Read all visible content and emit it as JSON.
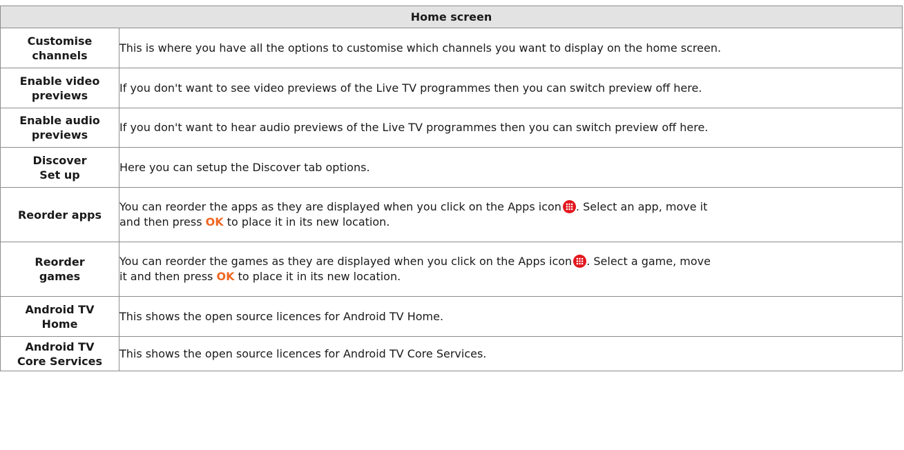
{
  "table": {
    "header": "Home screen",
    "rows": [
      {
        "label_line1": "Customise",
        "label_line2": "channels",
        "desc": "This is where you have all the options to customise which channels you want to display on the home screen."
      },
      {
        "label_line1": "Enable video",
        "label_line2": "previews",
        "desc": "If you don't want to see video previews of the Live TV programmes then you can switch preview off here."
      },
      {
        "label_line1": "Enable audio",
        "label_line2": "previews",
        "desc": "If you don't want to hear audio previews of the Live TV programmes then you can switch preview off here."
      },
      {
        "label_line1": "Discover",
        "label_line2": "Set up",
        "desc": "Here you can setup the Discover tab options."
      },
      {
        "label": "Reorder apps",
        "desc_a": "You can reorder the apps as they are displayed when you click on the Apps icon",
        "desc_b": ". Select an app, move it",
        "desc_c": "and then press",
        "desc_ok": "OK",
        "desc_d": "to place it in its new location.",
        "icon": "apps-grid-icon"
      },
      {
        "label_line1": "Reorder",
        "label_line2": "games",
        "desc_a": "You can reorder the games as they are displayed when you click on the Apps icon",
        "desc_b": ". Select a game, move",
        "desc_c": "it and then press",
        "desc_ok": "OK",
        "desc_d": "to place it in its new location.",
        "icon": "apps-grid-icon"
      },
      {
        "label_line1": "Android TV",
        "label_line2": "Home",
        "desc": "This shows the open source licences for Android TV Home."
      },
      {
        "label_line1": "Android TV",
        "label_line2": "Core Services",
        "desc": "This shows the open source licences for Android TV Core Services."
      }
    ]
  },
  "colors": {
    "header_bg": "#e3e3e3",
    "border": "#8c8c8c",
    "ok_text": "#ee6622",
    "apps_icon": "#e3161c"
  }
}
